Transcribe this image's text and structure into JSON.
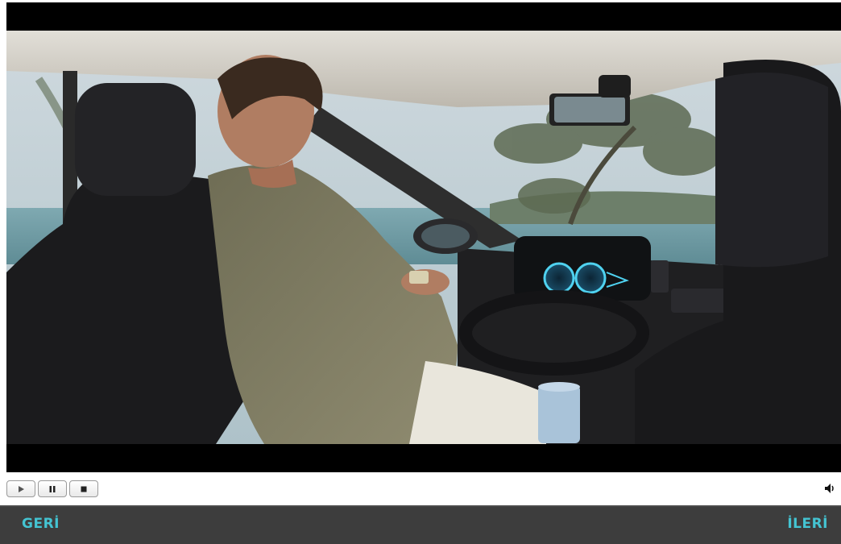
{
  "player": {
    "controls": {
      "play_icon": "play-icon",
      "pause_icon": "pause-icon",
      "stop_icon": "stop-icon",
      "volume_icon": "speaker-icon"
    }
  },
  "navigation": {
    "back_label": "GERİ",
    "next_label": "İLERİ"
  },
  "colors": {
    "nav_background": "#3d3d3d",
    "nav_text": "#44c4d2",
    "video_letterbox": "#000000"
  }
}
